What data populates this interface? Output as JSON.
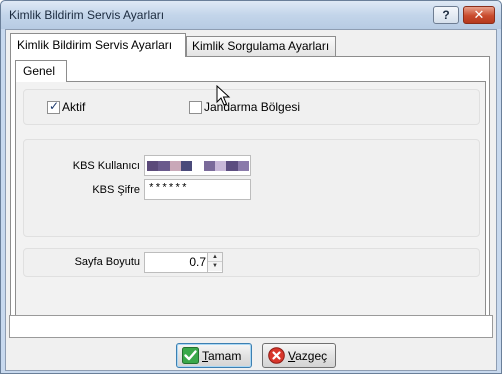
{
  "window": {
    "title": "Kimlik Bildirim Servis Ayarları",
    "help_label": "?",
    "close_label": "✕"
  },
  "tabs": [
    {
      "label": "Kimlik Bildirim Servis Ayarları",
      "active": true
    },
    {
      "label": "Kimlik Sorgulama Ayarları",
      "active": false
    }
  ],
  "subtab": {
    "label": "Genel"
  },
  "options": {
    "aktif": {
      "label": "Aktif",
      "checked": true
    },
    "jandarma": {
      "label": "Jandarma Bölgesi",
      "checked": false
    }
  },
  "credentials": {
    "username_label": "KBS Kullanıcı",
    "password_label": "KBS Şifre",
    "password_value": "******"
  },
  "page": {
    "size_label": "Sayfa Boyutu",
    "size_value": "0.7"
  },
  "buttons": {
    "ok_label": "Tamam",
    "cancel_label": "Vazgeç"
  },
  "colors": {
    "accent": "#3c7fb1",
    "masked_username": [
      "#5b4a7a",
      "#6a5a8c",
      "#c9a8b8",
      "#4a4a7a",
      "#ffffff",
      "#7a6a9a",
      "#c8b8d8",
      "#5c4d80",
      "#8a7aaa"
    ]
  }
}
